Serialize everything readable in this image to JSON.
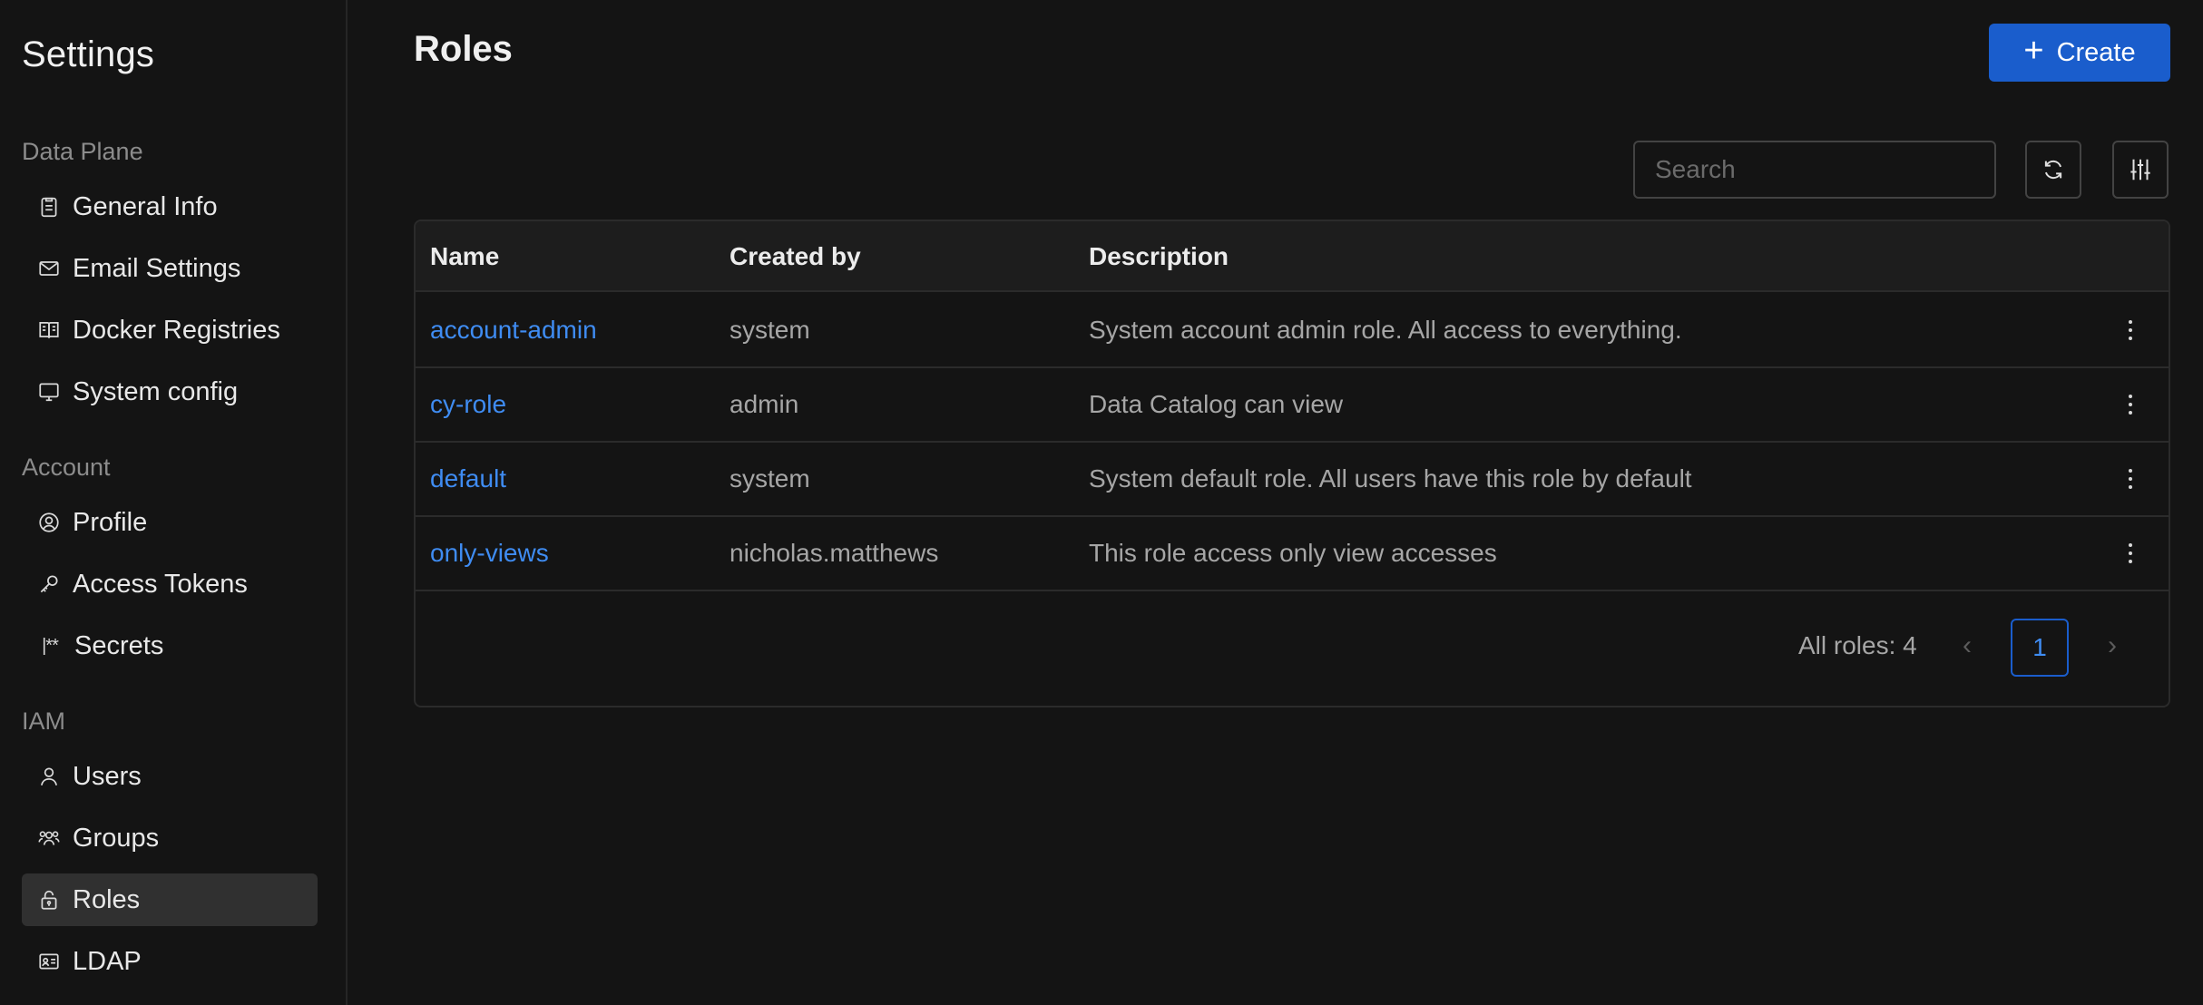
{
  "sidebar": {
    "title": "Settings",
    "sections": {
      "data_plane": "Data Plane",
      "account": "Account",
      "iam": "IAM"
    },
    "items": {
      "general_info": "General Info",
      "email_settings": "Email Settings",
      "docker_registries": "Docker Registries",
      "system_config": "System config",
      "profile": "Profile",
      "access_tokens": "Access Tokens",
      "secrets": "Secrets",
      "secrets_icon": "|**",
      "users": "Users",
      "groups": "Groups",
      "roles": "Roles",
      "ldap": "LDAP"
    },
    "active_item": "Roles"
  },
  "main": {
    "title": "Roles",
    "create_label": "Create",
    "search_placeholder": "Search",
    "table": {
      "columns": [
        "Name",
        "Created by",
        "Description"
      ],
      "rows": [
        {
          "name": "account-admin",
          "created_by": "system",
          "description": "System account admin role. All access to everything."
        },
        {
          "name": "cy-role",
          "created_by": "admin",
          "description": "Data Catalog can view"
        },
        {
          "name": "default",
          "created_by": "system",
          "description": "System default role. All users have this role by default"
        },
        {
          "name": "only-views",
          "created_by": "nicholas.matthews",
          "description": "This role access only view accesses"
        }
      ]
    },
    "pagination": {
      "total_label": "All roles: 4",
      "current_page": "1",
      "prev": "‹",
      "next": "›"
    }
  },
  "colors": {
    "background": "#141414",
    "accent": "#1a5dcc",
    "link": "#3f8cf2",
    "active_nav": "#303030"
  }
}
